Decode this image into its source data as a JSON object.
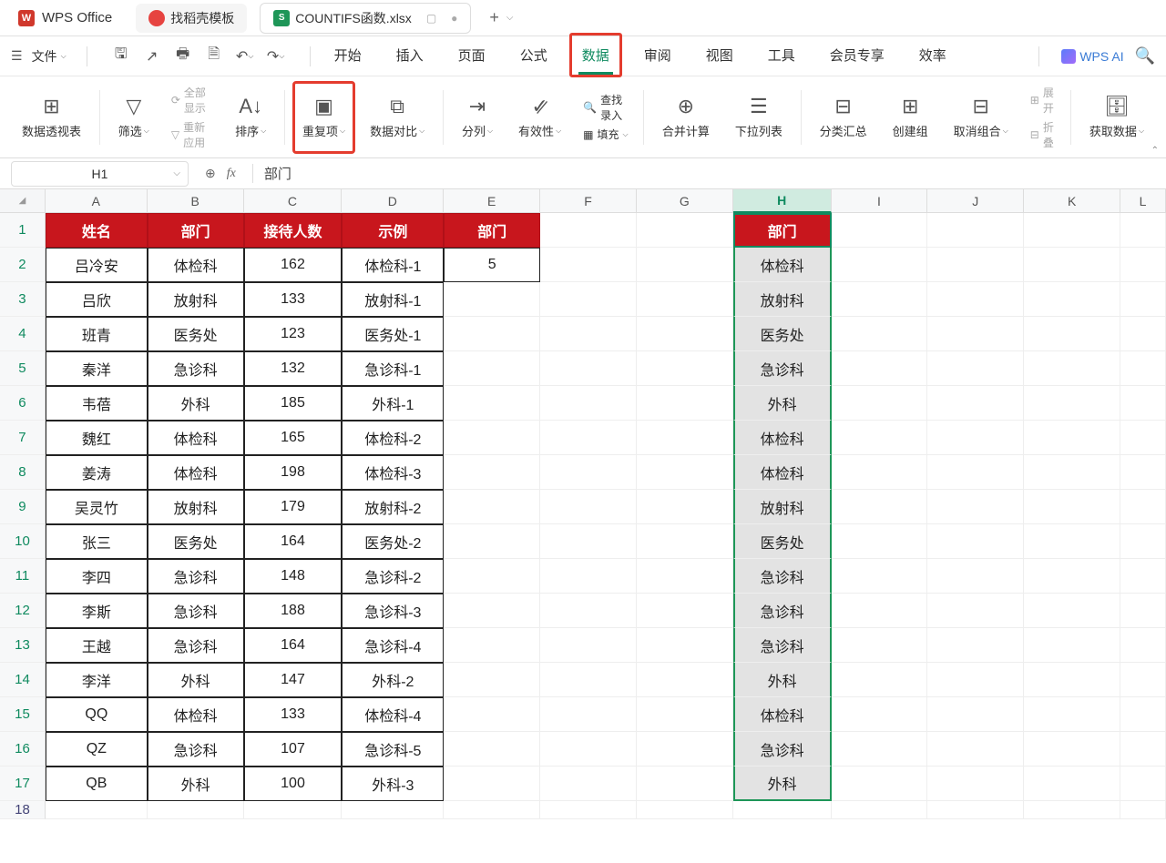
{
  "title_bar": {
    "wps_label": "WPS Office",
    "tab_template": "找稻壳模板",
    "filename": "COUNTIFS函数.xlsx",
    "new_tab": "+"
  },
  "menu": {
    "file_label": "文件",
    "items": [
      "开始",
      "插入",
      "页面",
      "公式",
      "数据",
      "审阅",
      "视图",
      "工具",
      "会员专享",
      "效率"
    ],
    "wps_ai": "WPS AI"
  },
  "ribbon": {
    "pivot": "数据透视表",
    "filter": "筛选",
    "show_all": "全部显示",
    "reapply": "重新应用",
    "sort": "排序",
    "duplicates": "重复项",
    "data_compare": "数据对比",
    "text_to_cols": "分列",
    "validity": "有效性",
    "find_entry": "查找录入",
    "fill": "填充",
    "consolidate": "合并计算",
    "dropdown": "下拉列表",
    "subtotal": "分类汇总",
    "group": "创建组",
    "ungroup": "取消组合",
    "expand": "展开",
    "collapse": "折叠",
    "get_data": "获取数据"
  },
  "formula_bar": {
    "name_box": "H1",
    "formula_value": "部门"
  },
  "columns": [
    "A",
    "B",
    "C",
    "D",
    "E",
    "F",
    "G",
    "H",
    "I",
    "J",
    "K",
    "L"
  ],
  "headers": {
    "A": "姓名",
    "B": "部门",
    "C": "接待人数",
    "D": "示例",
    "E": "部门",
    "H": "部门"
  },
  "rows": [
    {
      "r": 1,
      "A": "姓名",
      "B": "部门",
      "C": "接待人数",
      "D": "示例",
      "E": "部门",
      "H": "部门",
      "is_header": true
    },
    {
      "r": 2,
      "A": "吕冷安",
      "B": "体检科",
      "C": "162",
      "D": "体检科-1",
      "E": "5",
      "H": "体检科",
      "e_bord": true
    },
    {
      "r": 3,
      "A": "吕欣",
      "B": "放射科",
      "C": "133",
      "D": "放射科-1",
      "H": "放射科"
    },
    {
      "r": 4,
      "A": "班青",
      "B": "医务处",
      "C": "123",
      "D": "医务处-1",
      "H": "医务处"
    },
    {
      "r": 5,
      "A": "秦洋",
      "B": "急诊科",
      "C": "132",
      "D": "急诊科-1",
      "H": "急诊科"
    },
    {
      "r": 6,
      "A": "韦蓓",
      "B": "外科",
      "C": "185",
      "D": "外科-1",
      "H": "外科"
    },
    {
      "r": 7,
      "A": "魏红",
      "B": "体检科",
      "C": "165",
      "D": "体检科-2",
      "H": "体检科"
    },
    {
      "r": 8,
      "A": "姜涛",
      "B": "体检科",
      "C": "198",
      "D": "体检科-3",
      "H": "体检科"
    },
    {
      "r": 9,
      "A": "吴灵竹",
      "B": "放射科",
      "C": "179",
      "D": "放射科-2",
      "H": "放射科"
    },
    {
      "r": 10,
      "A": "张三",
      "B": "医务处",
      "C": "164",
      "D": "医务处-2",
      "H": "医务处"
    },
    {
      "r": 11,
      "A": "李四",
      "B": "急诊科",
      "C": "148",
      "D": "急诊科-2",
      "H": "急诊科"
    },
    {
      "r": 12,
      "A": "李斯",
      "B": "急诊科",
      "C": "188",
      "D": "急诊科-3",
      "H": "急诊科"
    },
    {
      "r": 13,
      "A": "王越",
      "B": "急诊科",
      "C": "164",
      "D": "急诊科-4",
      "H": "急诊科"
    },
    {
      "r": 14,
      "A": "李洋",
      "B": "外科",
      "C": "147",
      "D": "外科-2",
      "H": "外科"
    },
    {
      "r": 15,
      "A": "QQ",
      "B": "体检科",
      "C": "133",
      "D": "体检科-4",
      "H": "体检科"
    },
    {
      "r": 16,
      "A": "QZ",
      "B": "急诊科",
      "C": "107",
      "D": "急诊科-5",
      "H": "急诊科"
    },
    {
      "r": 17,
      "A": "QB",
      "B": "外科",
      "C": "100",
      "D": "外科-3",
      "H": "外科"
    },
    {
      "r": 18
    }
  ]
}
